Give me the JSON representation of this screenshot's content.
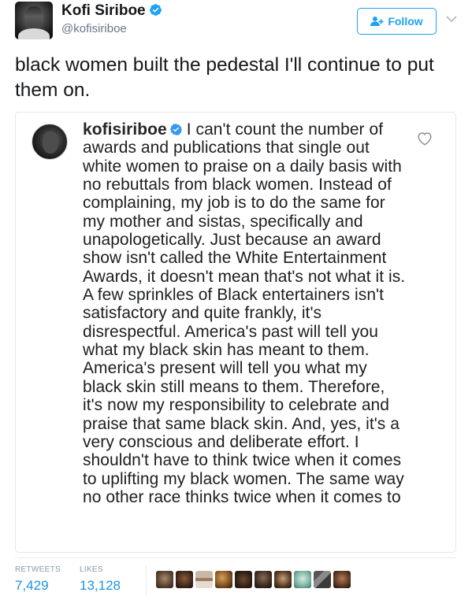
{
  "author": {
    "name": "Kofi Siriboe",
    "handle": "@kofisiriboe",
    "verified": true
  },
  "follow_button": {
    "label": "Follow",
    "icon": "add-user-icon"
  },
  "menu_icon": "chevron-down-icon",
  "tweet": {
    "text": "black women built the pedestal I'll continue to put them on."
  },
  "quoted_post": {
    "username": "kofisiriboe",
    "verified": true,
    "text": "I can't count the number of awards and publications that single out white women to praise on a daily basis with no rebuttals from black women. Instead of complaining, my job is to do the same for my mother and sistas, specifically and unapologetically. Just because an award show isn't called the White Entertainment Awards, it doesn't mean that's not what it is. A few sprinkles of Black entertainers isn't satisfactory and quite frankly, it's disrespectful. America's past will tell you what my black skin has meant to them. America's present will tell you what my black skin still means to them. Therefore, it's now my responsibility to celebrate and praise that same black skin. And, yes, it's a very conscious and deliberate effort. I shouldn't have to think twice when it comes to uplifting my black women. The same way no other race thinks twice when it comes to",
    "like_icon": "heart-outline-icon"
  },
  "stats": {
    "retweets_label": "RETWEETS",
    "retweets_value": "7,429",
    "likes_label": "LIKES",
    "likes_value": "13,128"
  },
  "colors": {
    "accent": "#1da1f2",
    "stat_value": "#1b95e0",
    "muted": "#657786"
  }
}
